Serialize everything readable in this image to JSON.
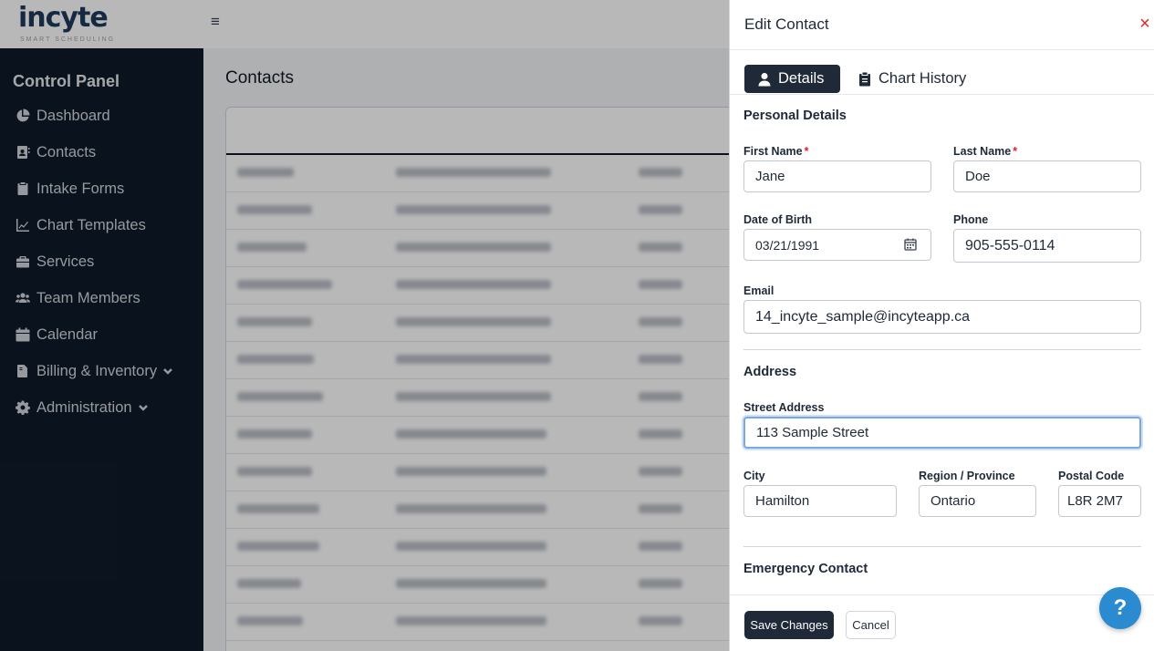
{
  "brand": {
    "name": "incyte",
    "tagline": "SMART SCHEDULING"
  },
  "sidebar": {
    "title": "Control Panel",
    "items": [
      {
        "label": "Dashboard",
        "icon": "chart-pie-icon"
      },
      {
        "label": "Contacts",
        "icon": "address-book-icon"
      },
      {
        "label": "Intake Forms",
        "icon": "clipboard-icon"
      },
      {
        "label": "Chart Templates",
        "icon": "line-chart-icon"
      },
      {
        "label": "Services",
        "icon": "briefcase-icon"
      },
      {
        "label": "Team Members",
        "icon": "users-icon"
      },
      {
        "label": "Calendar",
        "icon": "calendar-icon"
      },
      {
        "label": "Billing & Inventory",
        "icon": "file-invoice-icon",
        "expandable": true
      },
      {
        "label": "Administration",
        "icon": "gear-icon",
        "expandable": true
      }
    ]
  },
  "main": {
    "title": "Contacts"
  },
  "drawer": {
    "title": "Edit Contact",
    "close_glyph": "×",
    "tabs": [
      {
        "label": "Details",
        "active": true
      },
      {
        "label": "Chart History",
        "active": false
      }
    ],
    "sections": {
      "personal": "Personal Details",
      "address": "Address",
      "emergency": "Emergency Contact"
    },
    "fields": {
      "first_name": {
        "label": "First Name",
        "required_mark": "*",
        "value": "Jane"
      },
      "last_name": {
        "label": "Last Name",
        "required_mark": "*",
        "value": "Doe"
      },
      "dob": {
        "label": "Date of Birth",
        "value": "03/21/1991"
      },
      "phone": {
        "label": "Phone",
        "value": "905-555-0114"
      },
      "email": {
        "label": "Email",
        "value": "14_incyte_sample@incyteapp.ca"
      },
      "street": {
        "label": "Street Address",
        "value": "113 Sample Street"
      },
      "city": {
        "label": "City",
        "value": "Hamilton"
      },
      "region": {
        "label": "Region / Province",
        "value": "Ontario"
      },
      "postal": {
        "label": "Postal Code",
        "value": "L8R 2M7"
      }
    },
    "buttons": {
      "save": "Save Changes",
      "cancel": "Cancel",
      "help": "?"
    }
  },
  "colors": {
    "sidebar_bg": "#0f1b29",
    "primary_dark": "#1f2937",
    "required": "#dc2626",
    "help_button": "#2a8bd0",
    "focus_ring": "#7aa7e0"
  }
}
